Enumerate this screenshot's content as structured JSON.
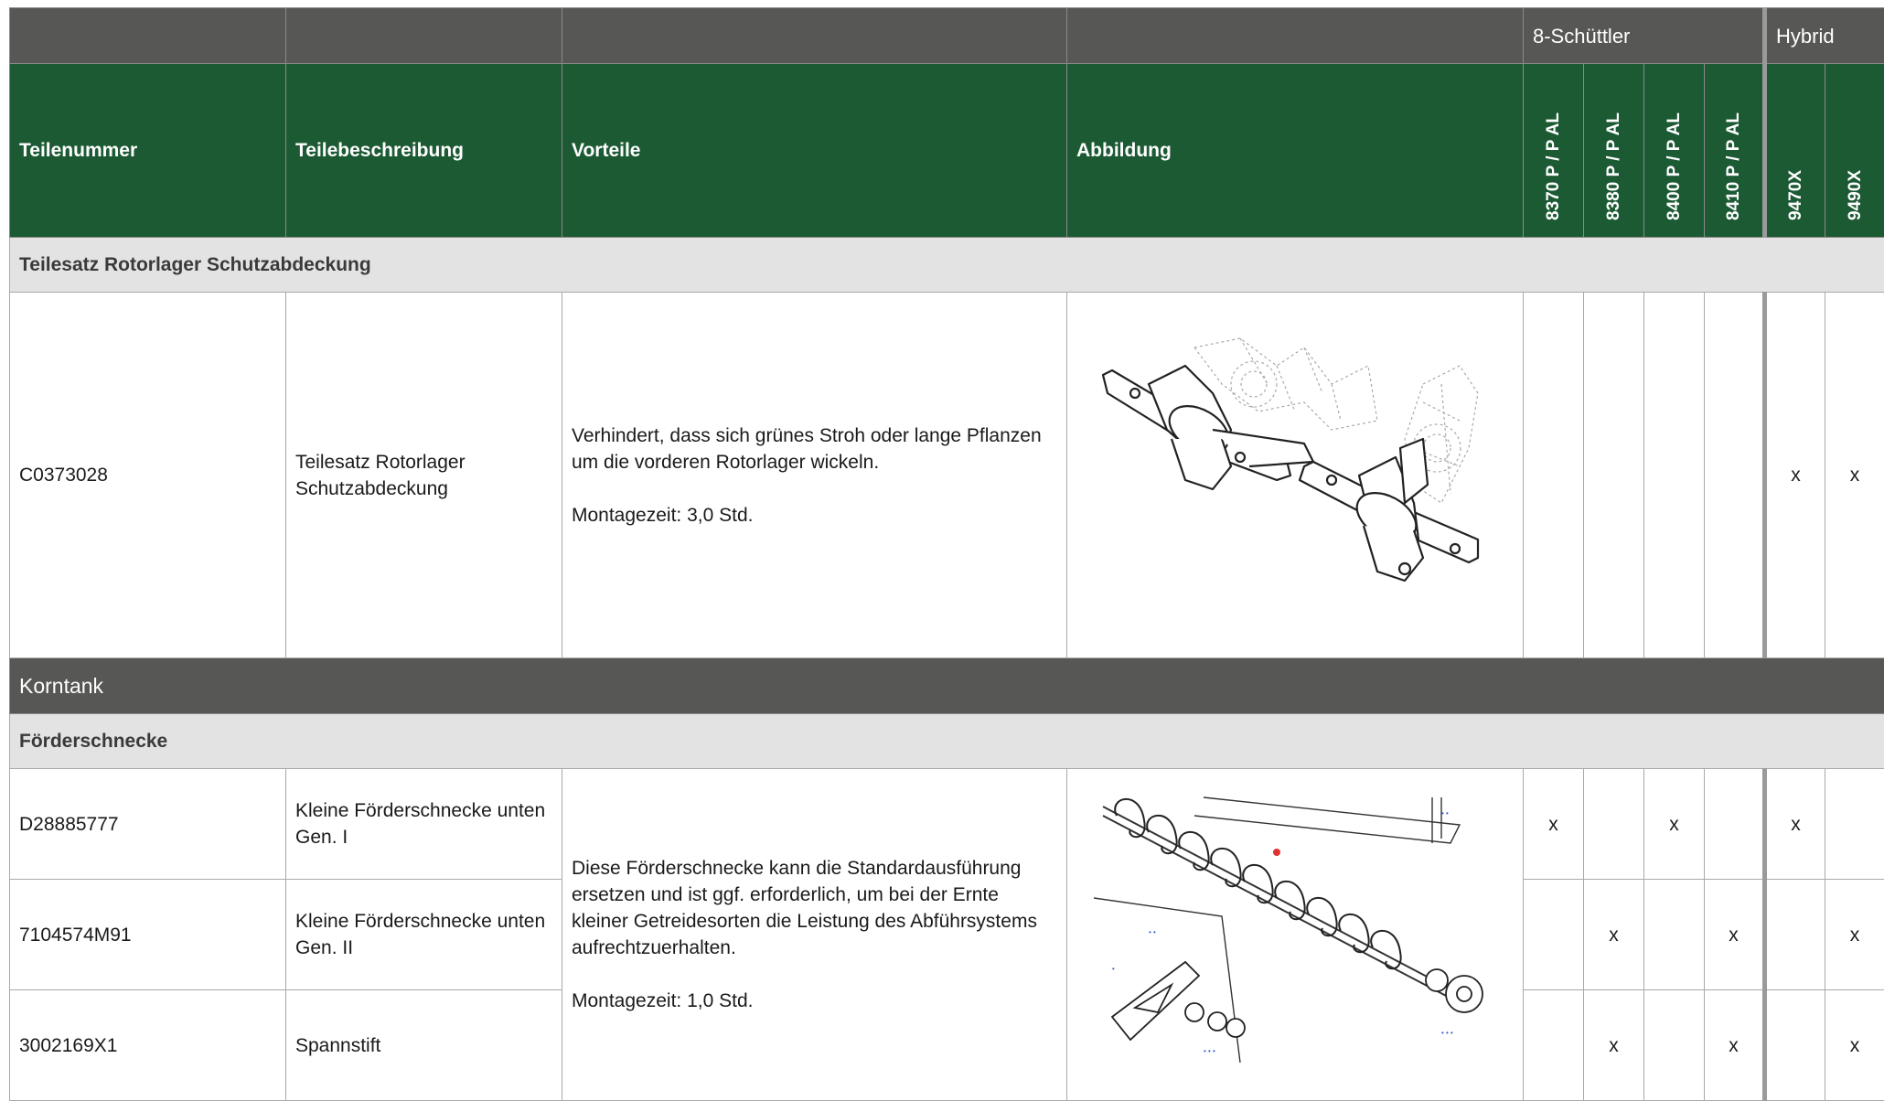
{
  "header": {
    "group_8_schuettler": "8-Schüttler",
    "group_hybrid": "Hybrid",
    "teilenummer": "Teilenummer",
    "teilebeschreibung": "Teilebeschreibung",
    "vorteile": "Vorteile",
    "abbildung": "Abbildung",
    "models": [
      "8370 P / P AL",
      "8380 P / P AL",
      "8400 P / P AL",
      "8410 P / P AL",
      "9470X",
      "9490X"
    ]
  },
  "section1": {
    "title": "Teilesatz Rotorlager Schutzabdeckung",
    "row": {
      "part_number": "C0373028",
      "description": "Teilesatz Rotorlager Schutzabdeckung",
      "benefit": "Verhindert, dass sich grünes Stroh oder lange Pflanzen um die vorderen Rotorlager wickeln.",
      "assembly_time": "Montagezeit: 3,0 Std.",
      "marks": [
        "",
        "",
        "",
        "",
        "x",
        "x"
      ]
    }
  },
  "section2": {
    "title": "Korntank",
    "subtitle": "Förderschnecke",
    "benefit": "Diese Förderschnecke kann die Standardausführung ersetzen und ist ggf. erforderlich, um bei der Ernte kleiner Getreidesorten die Leistung des Abführsystems aufrechtzuerhalten.",
    "assembly_time": "Montagezeit: 1,0 Std.",
    "rows": [
      {
        "part_number": "D28885777",
        "description": "Kleine Förderschnecke unten Gen. I",
        "marks": [
          "x",
          "",
          "x",
          "",
          "x",
          ""
        ]
      },
      {
        "part_number": "7104574M91",
        "description": "Kleine Förderschnecke unten Gen. II",
        "marks": [
          "",
          "x",
          "",
          "x",
          "",
          "x"
        ]
      },
      {
        "part_number": "3002169X1",
        "description": "Spannstift",
        "marks": [
          "",
          "x",
          "",
          "x",
          "",
          "x"
        ]
      }
    ]
  },
  "colors": {
    "header_green": "#1c5a34",
    "group_gray": "#575755",
    "section_light": "#e3e3e3"
  },
  "icons": [
    "rotor-bearing-cover-illustration",
    "auger-illustration"
  ]
}
